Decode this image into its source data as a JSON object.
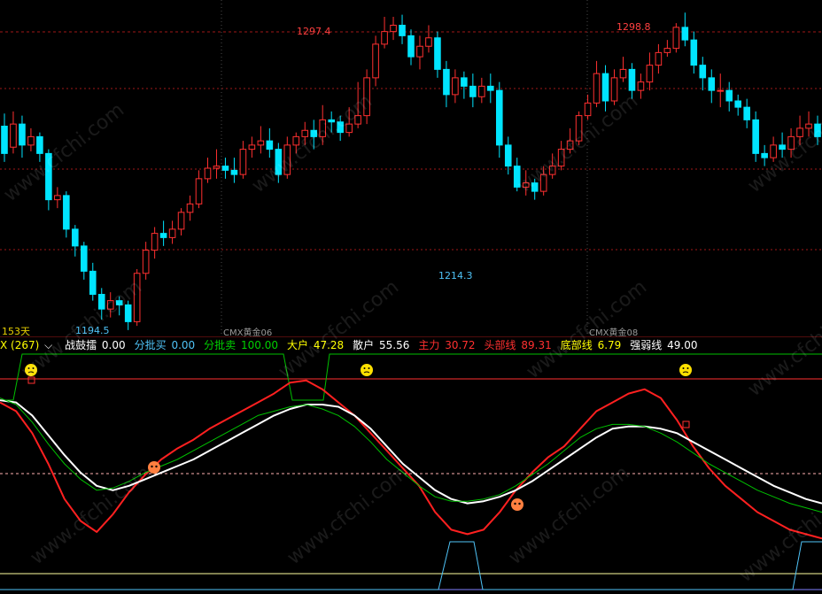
{
  "main": {
    "high1_label": "1297.4",
    "high2_label": "1298.8",
    "low1_label": "1194.5",
    "low2_label": "1214.3",
    "days_label": "153天",
    "contract1_label": "CMX黄金06",
    "contract2_label": "CMX黄金08"
  },
  "indicator": {
    "name": "X (267)",
    "items": [
      {
        "label": "战鼓擂",
        "value": "0.00",
        "color": "#ffffff"
      },
      {
        "label": "分批买",
        "value": "0.00",
        "color": "#4fc3f7"
      },
      {
        "label": "分批卖",
        "value": "100.00",
        "color": "#00d000"
      },
      {
        "label": "大户",
        "value": "47.28",
        "color": "#ffff00"
      },
      {
        "label": "散户",
        "value": "55.56",
        "color": "#ffffff"
      },
      {
        "label": "主力",
        "value": "30.72",
        "color": "#ff3030"
      },
      {
        "label": "头部线",
        "value": "89.31",
        "color": "#ff3030"
      },
      {
        "label": "底部线",
        "value": "6.79",
        "color": "#ffff00"
      },
      {
        "label": "强弱线",
        "value": "49.00",
        "color": "#ffffff"
      }
    ]
  },
  "watermark_text": "www.cfchi.com",
  "colors": {
    "up": "#ff3030",
    "down": "#00e5ff",
    "red_line": "#ff2020",
    "white_line": "#ffffff",
    "green_line": "#00c000",
    "cyan_line": "#4fc3f7"
  },
  "chart_data": {
    "type": "candlestick",
    "candles": [
      [
        1245,
        1232,
        1251,
        1228
      ],
      [
        1235,
        1246,
        1252,
        1232
      ],
      [
        1246,
        1236,
        1250,
        1230
      ],
      [
        1236,
        1240,
        1244,
        1233
      ],
      [
        1240,
        1232,
        1242,
        1228
      ],
      [
        1232,
        1210,
        1234,
        1205
      ],
      [
        1210,
        1212,
        1216,
        1206
      ],
      [
        1212,
        1196,
        1214,
        1192
      ],
      [
        1196,
        1188,
        1198,
        1183
      ],
      [
        1188,
        1176,
        1190,
        1172
      ],
      [
        1176,
        1165,
        1180,
        1162
      ],
      [
        1165,
        1158,
        1168,
        1153
      ],
      [
        1158,
        1162,
        1166,
        1154
      ],
      [
        1162,
        1160,
        1164,
        1155
      ],
      [
        1160,
        1152,
        1162,
        1148
      ],
      [
        1152,
        1175,
        1177,
        1150
      ],
      [
        1175,
        1186,
        1190,
        1172
      ],
      [
        1186,
        1194,
        1197,
        1182
      ],
      [
        1194,
        1192,
        1200,
        1188
      ],
      [
        1192,
        1196,
        1200,
        1189
      ],
      [
        1196,
        1204,
        1206,
        1193
      ],
      [
        1204,
        1208,
        1212,
        1200
      ],
      [
        1208,
        1220,
        1224,
        1206
      ],
      [
        1220,
        1225,
        1230,
        1218
      ],
      [
        1225,
        1226,
        1234,
        1220
      ],
      [
        1226,
        1224,
        1230,
        1220
      ],
      [
        1224,
        1222,
        1230,
        1218
      ],
      [
        1222,
        1234,
        1238,
        1220
      ],
      [
        1234,
        1236,
        1240,
        1230
      ],
      [
        1236,
        1238,
        1245,
        1232
      ],
      [
        1238,
        1234,
        1244,
        1230
      ],
      [
        1234,
        1222,
        1237,
        1218
      ],
      [
        1222,
        1236,
        1240,
        1220
      ],
      [
        1236,
        1240,
        1242,
        1232
      ],
      [
        1240,
        1243,
        1247,
        1236
      ],
      [
        1243,
        1240,
        1248,
        1234
      ],
      [
        1240,
        1248,
        1255,
        1236
      ],
      [
        1248,
        1247,
        1252,
        1242
      ],
      [
        1247,
        1242,
        1250,
        1238
      ],
      [
        1242,
        1246,
        1254,
        1240
      ],
      [
        1246,
        1250,
        1266,
        1244
      ],
      [
        1250,
        1268,
        1272,
        1246
      ],
      [
        1268,
        1284,
        1288,
        1264
      ],
      [
        1284,
        1290,
        1297,
        1282
      ],
      [
        1290,
        1293,
        1297,
        1286
      ],
      [
        1293,
        1288,
        1298,
        1284
      ],
      [
        1288,
        1278,
        1291,
        1274
      ],
      [
        1278,
        1283,
        1288,
        1272
      ],
      [
        1283,
        1287,
        1293,
        1280
      ],
      [
        1287,
        1272,
        1290,
        1268
      ],
      [
        1272,
        1260,
        1276,
        1254
      ],
      [
        1260,
        1268,
        1272,
        1256
      ],
      [
        1268,
        1264,
        1271,
        1258
      ],
      [
        1264,
        1259,
        1270,
        1254
      ],
      [
        1259,
        1264,
        1268,
        1256
      ],
      [
        1264,
        1262,
        1270,
        1256
      ],
      [
        1262,
        1236,
        1266,
        1230
      ],
      [
        1236,
        1226,
        1240,
        1222
      ],
      [
        1226,
        1216,
        1230,
        1214
      ],
      [
        1216,
        1218,
        1224,
        1212
      ],
      [
        1218,
        1214,
        1220,
        1210
      ],
      [
        1214,
        1222,
        1226,
        1212
      ],
      [
        1222,
        1226,
        1232,
        1220
      ],
      [
        1226,
        1234,
        1238,
        1224
      ],
      [
        1234,
        1238,
        1244,
        1232
      ],
      [
        1238,
        1250,
        1252,
        1236
      ],
      [
        1250,
        1256,
        1260,
        1248
      ],
      [
        1256,
        1270,
        1276,
        1254
      ],
      [
        1270,
        1257,
        1274,
        1252
      ],
      [
        1257,
        1268,
        1272,
        1255
      ],
      [
        1268,
        1272,
        1278,
        1266
      ],
      [
        1272,
        1262,
        1275,
        1258
      ],
      [
        1262,
        1266,
        1270,
        1258
      ],
      [
        1266,
        1274,
        1280,
        1262
      ],
      [
        1274,
        1280,
        1284,
        1270
      ],
      [
        1280,
        1282,
        1286,
        1278
      ],
      [
        1282,
        1292,
        1294,
        1280
      ],
      [
        1292,
        1286,
        1299,
        1283
      ],
      [
        1286,
        1274,
        1290,
        1270
      ],
      [
        1274,
        1268,
        1278,
        1262
      ],
      [
        1268,
        1262,
        1272,
        1256
      ],
      [
        1262,
        1262,
        1270,
        1254
      ],
      [
        1262,
        1257,
        1266,
        1252
      ],
      [
        1257,
        1254,
        1260,
        1250
      ],
      [
        1254,
        1248,
        1258,
        1244
      ],
      [
        1248,
        1232,
        1252,
        1228
      ],
      [
        1232,
        1230,
        1236,
        1226
      ],
      [
        1230,
        1236,
        1240,
        1228
      ],
      [
        1236,
        1234,
        1242,
        1230
      ],
      [
        1234,
        1240,
        1244,
        1230
      ],
      [
        1240,
        1244,
        1250,
        1236
      ],
      [
        1244,
        1246,
        1252,
        1240
      ],
      [
        1246,
        1240,
        1250,
        1236
      ]
    ],
    "indicator_series": [
      {
        "name": "主力",
        "color": "#ff2020",
        "values": [
          78,
          74,
          64,
          50,
          34,
          24,
          19,
          27,
          37,
          45,
          52,
          57,
          61,
          66,
          70,
          74,
          78,
          82,
          87,
          88,
          84,
          78,
          72,
          64,
          56,
          48,
          40,
          28,
          20,
          18,
          20,
          28,
          38,
          46,
          53,
          58,
          66,
          74,
          78,
          82,
          84,
          80,
          70,
          58,
          48,
          40,
          34,
          28,
          24,
          20,
          18,
          16
        ]
      },
      {
        "name": "强弱线",
        "color": "#ffffff",
        "values": [
          79,
          78,
          72,
          63,
          54,
          46,
          40,
          38,
          40,
          43,
          46,
          49,
          52,
          56,
          60,
          64,
          68,
          72,
          75,
          77,
          77,
          76,
          72,
          66,
          58,
          50,
          44,
          38,
          34,
          32,
          33,
          35,
          38,
          42,
          47,
          52,
          57,
          62,
          66,
          67,
          67,
          66,
          64,
          60,
          56,
          52,
          48,
          44,
          40,
          37,
          34,
          32
        ]
      },
      {
        "name": "分批卖",
        "color": "#00c000",
        "values": [
          80,
          77,
          69,
          59,
          50,
          43,
          38,
          39,
          42,
          46,
          49,
          52,
          56,
          60,
          64,
          68,
          72,
          74,
          76,
          77,
          75,
          72,
          67,
          60,
          52,
          46,
          40,
          35,
          33,
          33,
          34,
          36,
          40,
          45,
          50,
          56,
          62,
          66,
          68,
          68,
          67,
          64,
          60,
          55,
          50,
          46,
          42,
          38,
          35,
          32,
          30,
          28
        ]
      },
      {
        "name": "分批买",
        "color": "#4fc3f7",
        "values": [
          0,
          0,
          0,
          0,
          0,
          0,
          0,
          0,
          0,
          0,
          0,
          0,
          0,
          0,
          0,
          0,
          0,
          0,
          0,
          0,
          0,
          0,
          0,
          0,
          0,
          0,
          0,
          0,
          0,
          0,
          0,
          0,
          0,
          0,
          0,
          0,
          0,
          0,
          0,
          0,
          0,
          0,
          0,
          0,
          0,
          0,
          0,
          0,
          0,
          0,
          0,
          0
        ]
      }
    ],
    "ylim": [
      1145,
      1305
    ],
    "indicator_ylim": [
      0,
      100
    ]
  }
}
